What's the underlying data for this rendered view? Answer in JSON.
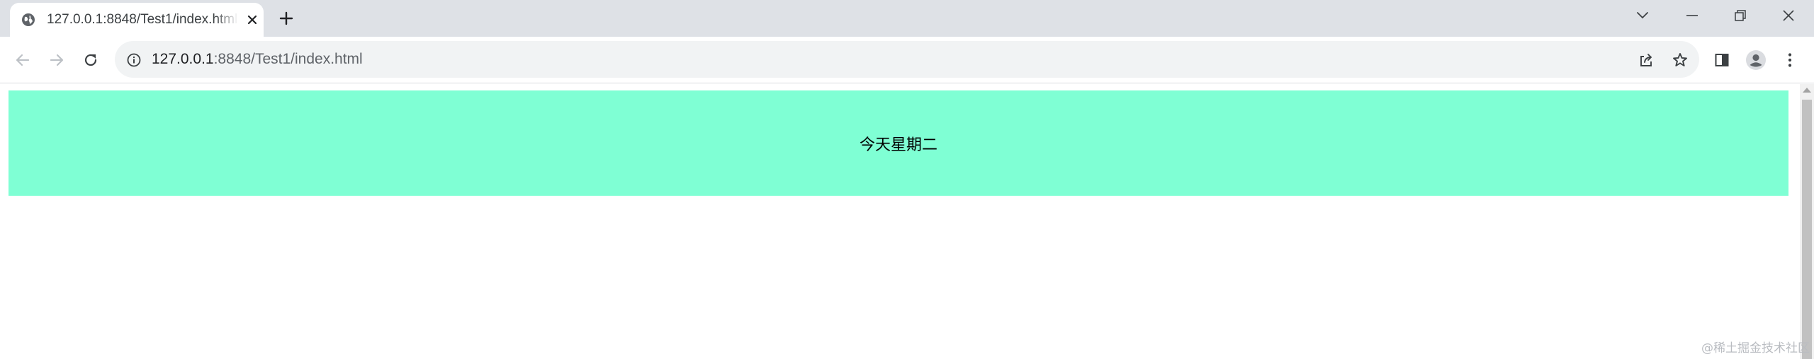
{
  "tab": {
    "title": "127.0.0.1:8848/Test1/index.html",
    "favicon": "globe-icon"
  },
  "window_controls": {
    "icons": [
      "tab-search-icon",
      "minimize-icon",
      "restore-icon",
      "close-window-icon"
    ]
  },
  "toolbar": {
    "back_icon": "back-arrow-icon",
    "forward_icon": "forward-arrow-icon",
    "reload_icon": "reload-icon",
    "right_icons": [
      "share-icon",
      "bookmark-star-icon",
      "side-panel-icon",
      "profile-avatar-icon",
      "kebab-menu-icon"
    ]
  },
  "address_bar": {
    "host": "127.0.0.1",
    "rest": ":8848/Test1/index.html",
    "info_icon": "info-icon"
  },
  "page": {
    "banner_text": "今天星期二",
    "banner_color": "#7fffd4"
  },
  "watermark": "@稀土掘金技术社区"
}
